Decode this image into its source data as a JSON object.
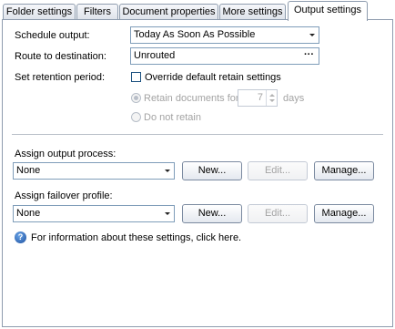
{
  "tabs": [
    {
      "label": "Folder settings"
    },
    {
      "label": "Filters"
    },
    {
      "label": "Document properties"
    },
    {
      "label": "More settings"
    },
    {
      "label": "Output settings",
      "active": true
    }
  ],
  "schedule": {
    "label": "Schedule output:",
    "value": "Today As Soon As Possible",
    "icon": "chevron-down-icon"
  },
  "route": {
    "label": "Route to destination:",
    "value": "Unrouted",
    "button": "···"
  },
  "retention": {
    "label": "Set retention period:",
    "override_label": "Override default retain settings",
    "override_checked": false,
    "retain_label": "Retain documents for",
    "retain_value": "7",
    "days_label": "days",
    "no_retain_label": "Do not retain",
    "selected": "retain"
  },
  "output_process": {
    "label": "Assign output process:",
    "value": "None",
    "new_label": "New...",
    "edit_label": "Edit...",
    "manage_label": "Manage..."
  },
  "failover": {
    "label": "Assign failover profile:",
    "value": "None",
    "new_label": "New...",
    "edit_label": "Edit...",
    "manage_label": "Manage..."
  },
  "help": {
    "text": "For information about these settings, click here.",
    "icon": "help-icon",
    "icon_glyph": "?"
  },
  "colors": {
    "border": "#8e9cae",
    "disabled_text": "#a3a3a3",
    "help_blue": "#1d4f9e"
  }
}
